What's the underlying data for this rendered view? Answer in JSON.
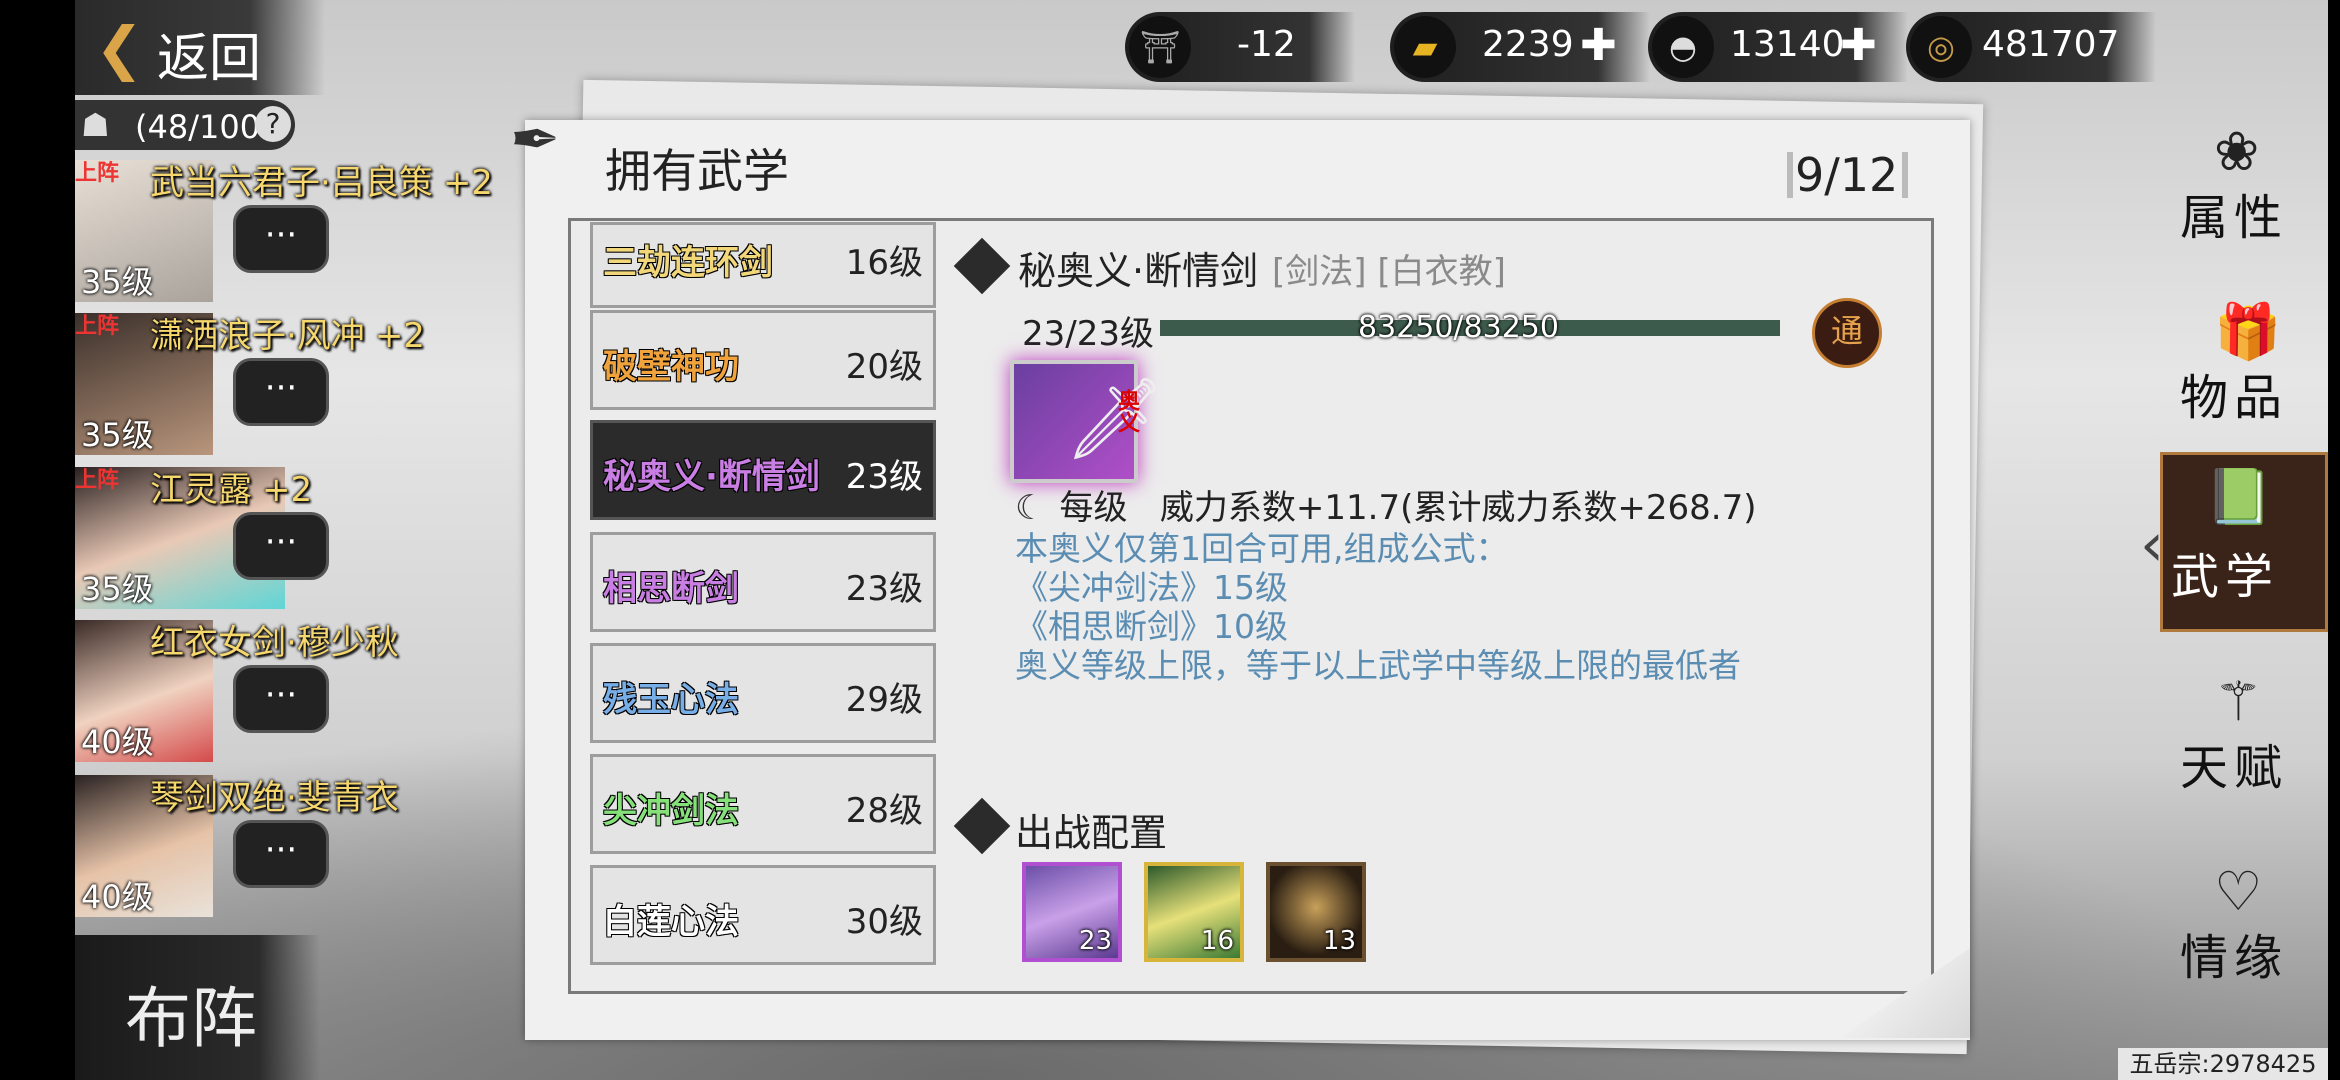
{
  "back": {
    "label": "返回"
  },
  "currencies": [
    {
      "icon": "cauldron-icon",
      "value": "-12",
      "has_plus": false
    },
    {
      "icon": "gold-bar-icon",
      "value": "2239",
      "has_plus": true
    },
    {
      "icon": "silver-ingot-icon",
      "value": "13140",
      "has_plus": true
    },
    {
      "icon": "copper-coin-icon",
      "value": "481707",
      "has_plus": false
    }
  ],
  "team": {
    "capacity": "(48/100"
  },
  "heroes": [
    {
      "name": "武当六君子·吕良策",
      "bonus": "+2",
      "level": "35级",
      "deployed": "上阵"
    },
    {
      "name": "潇洒浪子·风冲",
      "bonus": "+2",
      "level": "35级",
      "deployed": "上阵"
    },
    {
      "name": "江灵露",
      "bonus": "+2",
      "level": "35级",
      "deployed": "上阵"
    },
    {
      "name": "红衣女剑·穆少秋",
      "bonus": "",
      "level": "40级",
      "deployed": ""
    },
    {
      "name": "琴剑双绝·斐青衣",
      "bonus": "",
      "level": "40级",
      "deployed": ""
    }
  ],
  "buzhen": {
    "label": "布阵"
  },
  "panel": {
    "title": "拥有武学",
    "count": "9/12"
  },
  "skills": [
    {
      "name": "三劫连环剑",
      "level": "16级",
      "color": "#f1d77a"
    },
    {
      "name": "破壁神功",
      "level": "20级",
      "color": "#f0a33c"
    },
    {
      "name": "秘奥义·断情剑",
      "level": "23级",
      "color": "#c97ee3"
    },
    {
      "name": "相思断剑",
      "level": "23级",
      "color": "#c97ee3"
    },
    {
      "name": "残玉心法",
      "level": "29级",
      "color": "#78aee8"
    },
    {
      "name": "尖冲剑法",
      "level": "28级",
      "color": "#86e07a"
    },
    {
      "name": "白莲心法",
      "level": "30级",
      "color": "#ffffff"
    }
  ],
  "detail": {
    "name": "秘奥义·断情剑",
    "tags": "[剑法] [白衣教]",
    "level": "23/23级",
    "exp": "83250/83250",
    "exp_progress": 1.0,
    "tong_label": "通",
    "icon_tag": "奥义",
    "per_level_label": "每级",
    "per_level_value": "威力系数+11.7(累计威力系数+268.7)",
    "desc_lines": [
      "本奥义仅第1回合可用,组成公式：",
      "《尖冲剑法》15级",
      "《相思断剑》10级",
      "奥义等级上限，等于以上武学中等级上限的最低者"
    ]
  },
  "battle_config": {
    "title": "出战配置",
    "slots": [
      {
        "icon": "purple-slash-icon",
        "value": "23",
        "border": "#b04fd0"
      },
      {
        "icon": "gold-blade-icon",
        "value": "16",
        "border": "#d7b43a"
      },
      {
        "icon": "meditation-icon",
        "value": "13",
        "border": "#6b5030"
      }
    ]
  },
  "tabs": [
    {
      "icon": "flower-icon",
      "label": "属性"
    },
    {
      "icon": "gift-box-icon",
      "label": "物品"
    },
    {
      "icon": "book-icon",
      "label": "武学"
    },
    {
      "icon": "talent-icon",
      "label": "天赋"
    },
    {
      "icon": "heart-knot-icon",
      "label": "情缘"
    }
  ],
  "footer": {
    "server": "五岳宗:2978425"
  }
}
